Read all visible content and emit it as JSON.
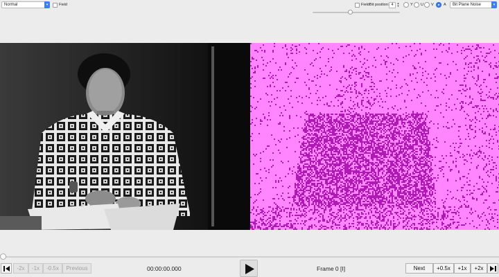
{
  "toolbar": {
    "mode_select": "Normal",
    "field_left_label": "Field",
    "field_right_label": "Field",
    "bit_position_label": "Bit position:",
    "bit_position_value": "4",
    "channels": [
      {
        "label": "Y",
        "selected": false
      },
      {
        "label": "U",
        "selected": false
      },
      {
        "label": "V",
        "selected": false
      },
      {
        "label": "A",
        "selected": true
      }
    ],
    "filter_select": "Bit Plane Noise"
  },
  "transport": {
    "back_2x": "-2x",
    "back_1x": "-1x",
    "back_half": "-0.5x",
    "previous": "Previous",
    "timecode": "00:00:00.000",
    "frame_label": "Frame 0 [I]",
    "next": "Next",
    "fwd_half": "+0.5x",
    "fwd_1x": "+1x",
    "fwd_2x": "+2x"
  },
  "colors": {
    "accent": "#3d7ff0",
    "filter_background": "#ff86ff",
    "filter_foreground": "#b01ab4"
  },
  "icons": {
    "prev_frame": "step-back-icon",
    "next_frame": "step-forward-icon",
    "play": "play-icon"
  }
}
